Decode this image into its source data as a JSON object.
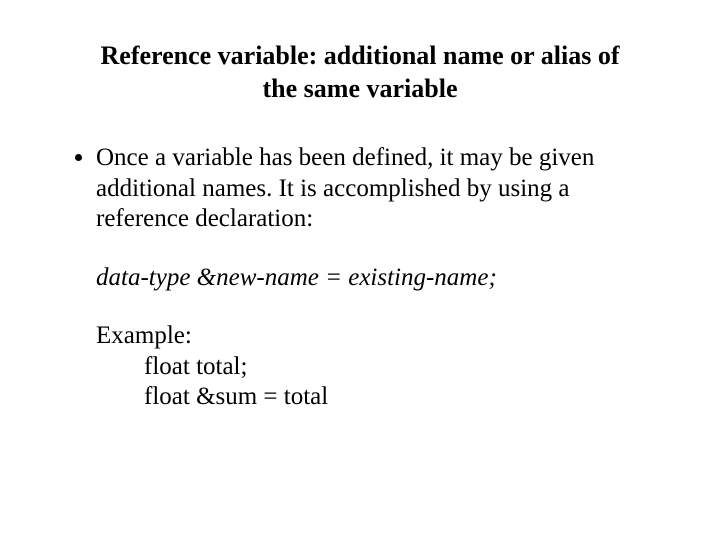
{
  "title_line1": "Reference variable: additional name or alias of",
  "title_line2": "the same variable",
  "bullet1": "Once a variable has been defined, it may be given additional names. It is accomplished by using a reference declaration:",
  "syntax": "data-type &new-name = existing-name;",
  "example_label": "Example:",
  "example_line1": "float total;",
  "example_line2": "float &sum = total"
}
